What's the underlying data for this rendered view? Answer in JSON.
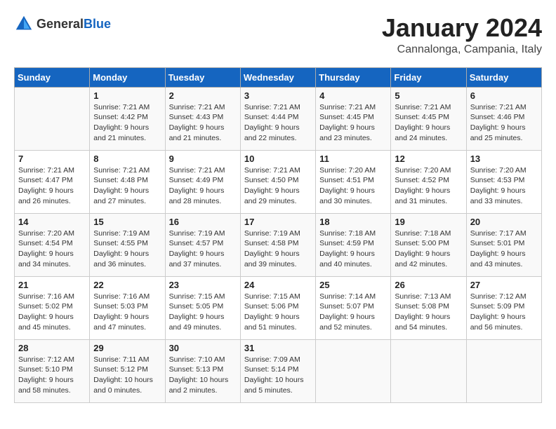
{
  "header": {
    "logo": {
      "general": "General",
      "blue": "Blue"
    },
    "title": "January 2024",
    "location": "Cannalonga, Campania, Italy"
  },
  "weekdays": [
    "Sunday",
    "Monday",
    "Tuesday",
    "Wednesday",
    "Thursday",
    "Friday",
    "Saturday"
  ],
  "weeks": [
    [
      {
        "day": "",
        "sunrise": "",
        "sunset": "",
        "daylight": ""
      },
      {
        "day": "1",
        "sunrise": "Sunrise: 7:21 AM",
        "sunset": "Sunset: 4:42 PM",
        "daylight": "Daylight: 9 hours and 21 minutes."
      },
      {
        "day": "2",
        "sunrise": "Sunrise: 7:21 AM",
        "sunset": "Sunset: 4:43 PM",
        "daylight": "Daylight: 9 hours and 21 minutes."
      },
      {
        "day": "3",
        "sunrise": "Sunrise: 7:21 AM",
        "sunset": "Sunset: 4:44 PM",
        "daylight": "Daylight: 9 hours and 22 minutes."
      },
      {
        "day": "4",
        "sunrise": "Sunrise: 7:21 AM",
        "sunset": "Sunset: 4:45 PM",
        "daylight": "Daylight: 9 hours and 23 minutes."
      },
      {
        "day": "5",
        "sunrise": "Sunrise: 7:21 AM",
        "sunset": "Sunset: 4:45 PM",
        "daylight": "Daylight: 9 hours and 24 minutes."
      },
      {
        "day": "6",
        "sunrise": "Sunrise: 7:21 AM",
        "sunset": "Sunset: 4:46 PM",
        "daylight": "Daylight: 9 hours and 25 minutes."
      }
    ],
    [
      {
        "day": "7",
        "sunrise": "Sunrise: 7:21 AM",
        "sunset": "Sunset: 4:47 PM",
        "daylight": "Daylight: 9 hours and 26 minutes."
      },
      {
        "day": "8",
        "sunrise": "Sunrise: 7:21 AM",
        "sunset": "Sunset: 4:48 PM",
        "daylight": "Daylight: 9 hours and 27 minutes."
      },
      {
        "day": "9",
        "sunrise": "Sunrise: 7:21 AM",
        "sunset": "Sunset: 4:49 PM",
        "daylight": "Daylight: 9 hours and 28 minutes."
      },
      {
        "day": "10",
        "sunrise": "Sunrise: 7:21 AM",
        "sunset": "Sunset: 4:50 PM",
        "daylight": "Daylight: 9 hours and 29 minutes."
      },
      {
        "day": "11",
        "sunrise": "Sunrise: 7:20 AM",
        "sunset": "Sunset: 4:51 PM",
        "daylight": "Daylight: 9 hours and 30 minutes."
      },
      {
        "day": "12",
        "sunrise": "Sunrise: 7:20 AM",
        "sunset": "Sunset: 4:52 PM",
        "daylight": "Daylight: 9 hours and 31 minutes."
      },
      {
        "day": "13",
        "sunrise": "Sunrise: 7:20 AM",
        "sunset": "Sunset: 4:53 PM",
        "daylight": "Daylight: 9 hours and 33 minutes."
      }
    ],
    [
      {
        "day": "14",
        "sunrise": "Sunrise: 7:20 AM",
        "sunset": "Sunset: 4:54 PM",
        "daylight": "Daylight: 9 hours and 34 minutes."
      },
      {
        "day": "15",
        "sunrise": "Sunrise: 7:19 AM",
        "sunset": "Sunset: 4:55 PM",
        "daylight": "Daylight: 9 hours and 36 minutes."
      },
      {
        "day": "16",
        "sunrise": "Sunrise: 7:19 AM",
        "sunset": "Sunset: 4:57 PM",
        "daylight": "Daylight: 9 hours and 37 minutes."
      },
      {
        "day": "17",
        "sunrise": "Sunrise: 7:19 AM",
        "sunset": "Sunset: 4:58 PM",
        "daylight": "Daylight: 9 hours and 39 minutes."
      },
      {
        "day": "18",
        "sunrise": "Sunrise: 7:18 AM",
        "sunset": "Sunset: 4:59 PM",
        "daylight": "Daylight: 9 hours and 40 minutes."
      },
      {
        "day": "19",
        "sunrise": "Sunrise: 7:18 AM",
        "sunset": "Sunset: 5:00 PM",
        "daylight": "Daylight: 9 hours and 42 minutes."
      },
      {
        "day": "20",
        "sunrise": "Sunrise: 7:17 AM",
        "sunset": "Sunset: 5:01 PM",
        "daylight": "Daylight: 9 hours and 43 minutes."
      }
    ],
    [
      {
        "day": "21",
        "sunrise": "Sunrise: 7:16 AM",
        "sunset": "Sunset: 5:02 PM",
        "daylight": "Daylight: 9 hours and 45 minutes."
      },
      {
        "day": "22",
        "sunrise": "Sunrise: 7:16 AM",
        "sunset": "Sunset: 5:03 PM",
        "daylight": "Daylight: 9 hours and 47 minutes."
      },
      {
        "day": "23",
        "sunrise": "Sunrise: 7:15 AM",
        "sunset": "Sunset: 5:05 PM",
        "daylight": "Daylight: 9 hours and 49 minutes."
      },
      {
        "day": "24",
        "sunrise": "Sunrise: 7:15 AM",
        "sunset": "Sunset: 5:06 PM",
        "daylight": "Daylight: 9 hours and 51 minutes."
      },
      {
        "day": "25",
        "sunrise": "Sunrise: 7:14 AM",
        "sunset": "Sunset: 5:07 PM",
        "daylight": "Daylight: 9 hours and 52 minutes."
      },
      {
        "day": "26",
        "sunrise": "Sunrise: 7:13 AM",
        "sunset": "Sunset: 5:08 PM",
        "daylight": "Daylight: 9 hours and 54 minutes."
      },
      {
        "day": "27",
        "sunrise": "Sunrise: 7:12 AM",
        "sunset": "Sunset: 5:09 PM",
        "daylight": "Daylight: 9 hours and 56 minutes."
      }
    ],
    [
      {
        "day": "28",
        "sunrise": "Sunrise: 7:12 AM",
        "sunset": "Sunset: 5:10 PM",
        "daylight": "Daylight: 9 hours and 58 minutes."
      },
      {
        "day": "29",
        "sunrise": "Sunrise: 7:11 AM",
        "sunset": "Sunset: 5:12 PM",
        "daylight": "Daylight: 10 hours and 0 minutes."
      },
      {
        "day": "30",
        "sunrise": "Sunrise: 7:10 AM",
        "sunset": "Sunset: 5:13 PM",
        "daylight": "Daylight: 10 hours and 2 minutes."
      },
      {
        "day": "31",
        "sunrise": "Sunrise: 7:09 AM",
        "sunset": "Sunset: 5:14 PM",
        "daylight": "Daylight: 10 hours and 5 minutes."
      },
      {
        "day": "",
        "sunrise": "",
        "sunset": "",
        "daylight": ""
      },
      {
        "day": "",
        "sunrise": "",
        "sunset": "",
        "daylight": ""
      },
      {
        "day": "",
        "sunrise": "",
        "sunset": "",
        "daylight": ""
      }
    ]
  ]
}
